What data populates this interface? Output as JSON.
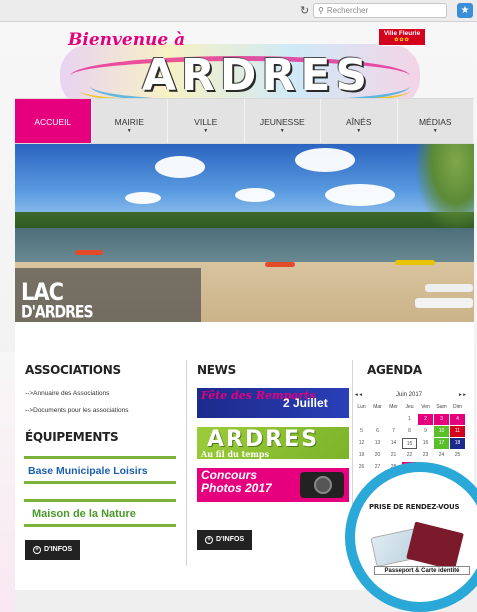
{
  "browser": {
    "reload_icon": "↻",
    "search_placeholder": "Rechercher",
    "extension_icon": "★"
  },
  "logo": {
    "welcome": "Bienvenue à",
    "name": "ARDRES",
    "badge": "Ville Fleurie",
    "badge_flowers": "✿✿✿"
  },
  "nav": {
    "items": [
      {
        "label": "ACCUEIL"
      },
      {
        "label": "MAIRIE"
      },
      {
        "label": "VILLE"
      },
      {
        "label": "JEUNESSE"
      },
      {
        "label": "AÎNÉS"
      },
      {
        "label": "MÉDIAS"
      }
    ]
  },
  "hero": {
    "title_line1": "LAC",
    "title_line2": "D'ARDRES"
  },
  "associations": {
    "title": "ASSOCIATIONS",
    "links": [
      "-->Annuaire des Associations",
      "-->Documents pour les associations"
    ]
  },
  "equipements": {
    "title": "ÉQUIPEMENTS",
    "banner1": "Base Municipale Loisirs",
    "banner2": "Maison de la Nature",
    "infos_label": "D'INFOS"
  },
  "news": {
    "title": "NEWS",
    "item1_a": "Fête des Remparts",
    "item1_b": "2 Juillet",
    "item2_a": "ARDRES",
    "item2_b": "Au fil du temps",
    "item3_a": "Concours Photos 2017",
    "infos_label": "D'INFOS"
  },
  "agenda": {
    "title": "AGENDA",
    "prev": "◂ ◂",
    "next": "▸ ▸",
    "month": "Juin 2017",
    "days": [
      "Lun",
      "Mar",
      "Mer",
      "Jeu",
      "Ven",
      "Sam",
      "Dim"
    ],
    "weeks": [
      [
        "",
        "",
        "",
        "1",
        "2",
        "3",
        "4"
      ],
      [
        "5",
        "6",
        "7",
        "8",
        "9",
        "10",
        "11"
      ],
      [
        "12",
        "13",
        "14",
        "15",
        "16",
        "17",
        "18"
      ],
      [
        "19",
        "20",
        "21",
        "22",
        "23",
        "24",
        "25"
      ],
      [
        "26",
        "27",
        "28",
        "29",
        "30",
        "",
        ""
      ]
    ]
  },
  "rdv": {
    "title": "PRISE DE RENDEZ-VOUS",
    "caption": "Passeport & Carte identité"
  },
  "colors": {
    "accent": "#e6007e",
    "agenda_green": "#5bbf2b",
    "agenda_red": "#d4001e",
    "agenda_blue": "#1c2a8a",
    "ring": "#2aa8d8"
  }
}
